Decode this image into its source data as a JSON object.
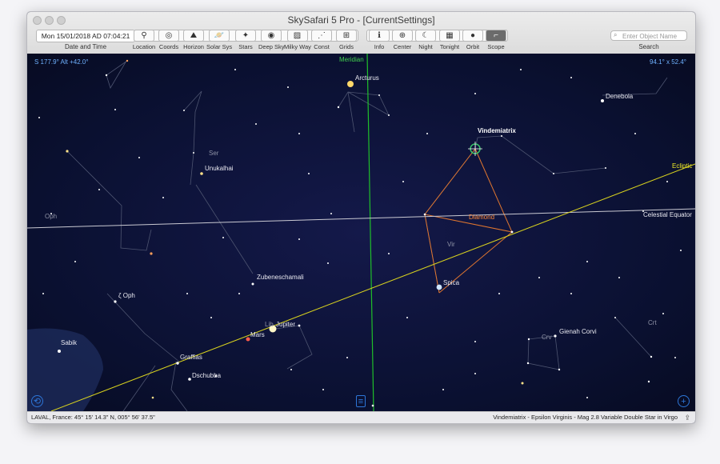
{
  "window": {
    "title": "SkySafari 5 Pro - [CurrentSettings]"
  },
  "toolbar": {
    "datetime_value": "Mon 15/01/2018 AD 07:04:21",
    "datetime_label": "Date and Time",
    "tools": [
      {
        "label": "Location",
        "icon": "location-icon",
        "glyph": "⚲"
      },
      {
        "label": "Coords",
        "icon": "coords-icon",
        "glyph": "◎"
      },
      {
        "label": "Horizon",
        "icon": "horizon-icon",
        "glyph": "⛰"
      },
      {
        "label": "Solar Sys",
        "icon": "planet-icon",
        "glyph": "🪐"
      },
      {
        "label": "Stars",
        "icon": "stars-icon",
        "glyph": "✦"
      },
      {
        "label": "Deep Sky",
        "icon": "galaxy-icon",
        "glyph": "◉"
      },
      {
        "label": "Milky Way",
        "icon": "milky-way-icon",
        "glyph": "▨"
      },
      {
        "label": "Const",
        "icon": "constellation-icon",
        "glyph": "⋰"
      },
      {
        "label": "Grids",
        "icon": "grid-icon",
        "glyph": "⊞"
      },
      {
        "label": "Info",
        "icon": "info-icon",
        "glyph": "ℹ"
      },
      {
        "label": "Center",
        "icon": "center-icon",
        "glyph": "⊕"
      },
      {
        "label": "Night",
        "icon": "night-icon",
        "glyph": "☾"
      },
      {
        "label": "Tonight",
        "icon": "calendar-icon",
        "glyph": "▦"
      },
      {
        "label": "Orbit",
        "icon": "orbit-icon",
        "glyph": "●"
      },
      {
        "label": "Scope",
        "icon": "telescope-icon",
        "glyph": "⌐"
      }
    ],
    "search_placeholder": "Enter Object Name",
    "search_label": "Search"
  },
  "sky": {
    "coord_left": "S 177.9° Alt +42.0°",
    "coord_right": "94.1° x 52.4°",
    "labels": {
      "meridian": "Meridian",
      "arcturus": "Arcturus",
      "denebola": "Denebola",
      "vindemiatrix": "Vindemiatrix",
      "ecliptic": "Ecliptic",
      "ser": "Ser",
      "unukalhai": "Unukalhai",
      "oph": "Oph",
      "diamond": "Diamond",
      "celestial_equator": "Celestial Equator",
      "vir": "Vir",
      "zubeneschamali": "Zubeneschamali",
      "spica": "Spica",
      "zeta_oph": "ζ Oph",
      "lib": "Lib",
      "jupiter": "Jupiter",
      "mars": "Mars",
      "gienah_corvi": "Gienah Corvi",
      "crv": "Crv",
      "crt": "Crt",
      "sabik": "Sabik",
      "graffias": "Graffias",
      "dschubba": "Dschubba"
    }
  },
  "status": {
    "location": "LAVAL, France: 45° 15' 14.3\" N, 005° 56' 37.5\"",
    "object_info": "Vindemiatrix - Epsilon Virginis - Mag 2.8 Variable Double Star in Virgo"
  },
  "colors": {
    "sky": "#0b1230",
    "meridian": "#1fbf2a",
    "ecliptic": "#d8d21e",
    "equator": "#c9c9d2",
    "diamond": "#e0762f",
    "coords": "#6fb1ff"
  }
}
